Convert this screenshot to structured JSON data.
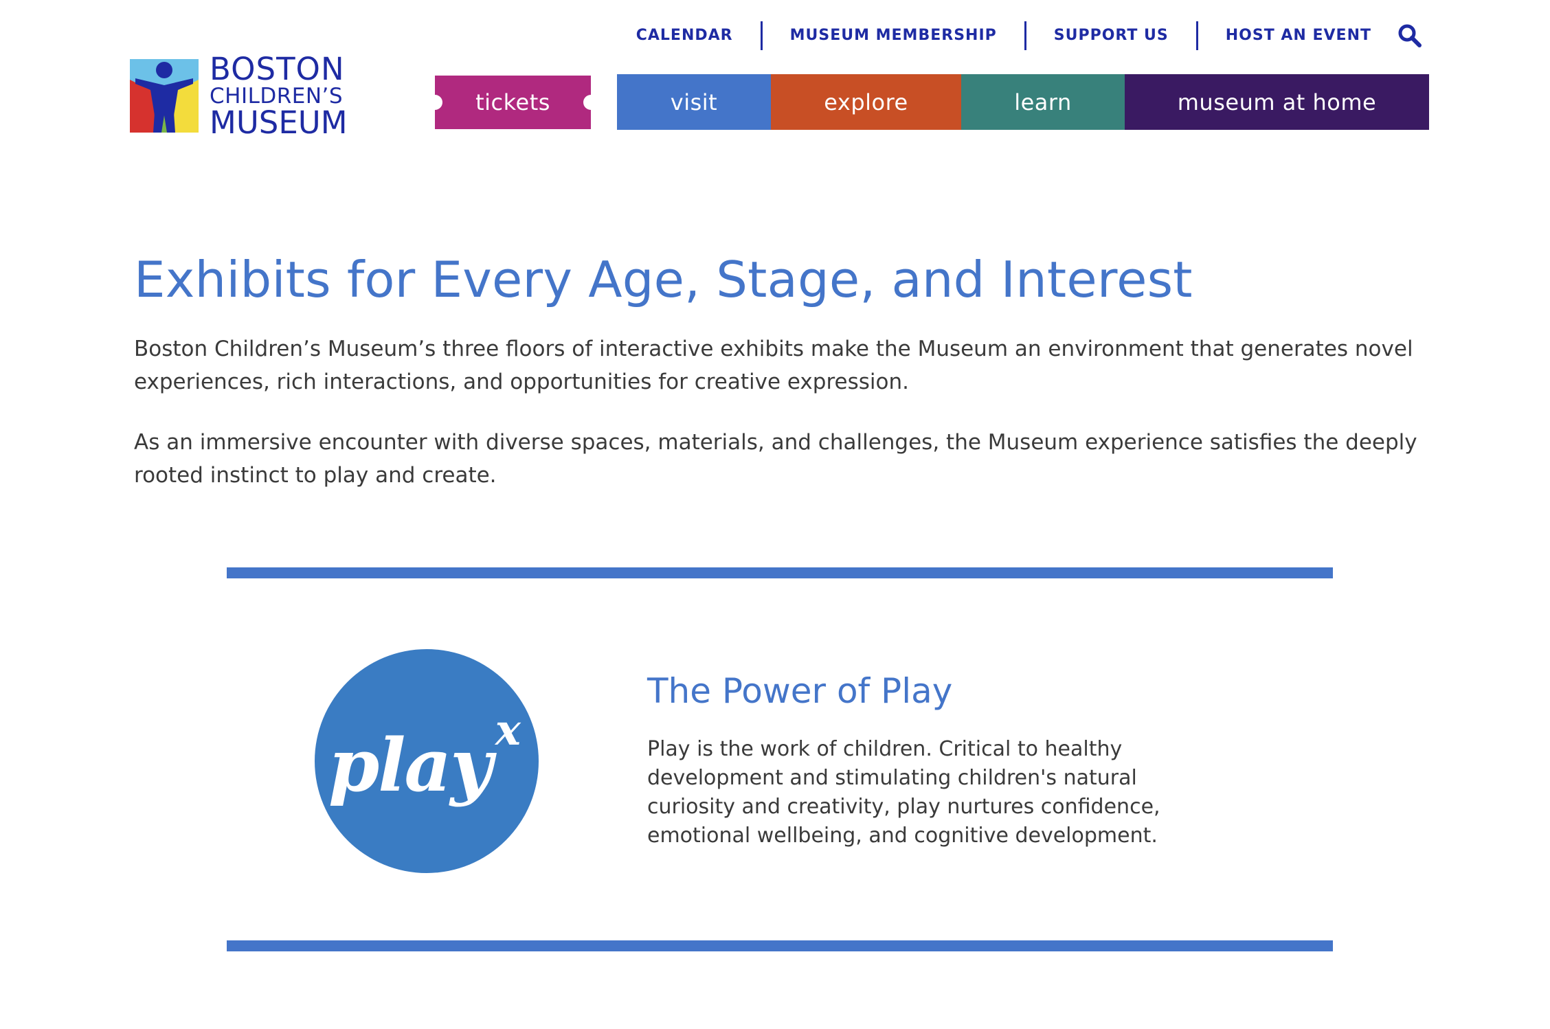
{
  "header": {
    "logo": {
      "line1": "BOSTON",
      "line2": "CHILDREN’S",
      "line3": "MUSEUM",
      "colors": {
        "sky": "#6cc1e8",
        "red": "#d6322e",
        "yellow": "#f3dc3c",
        "green": "#7ab648",
        "navy": "#1e2ba3"
      }
    },
    "utility_nav": [
      {
        "label": "CALENDAR"
      },
      {
        "label": "MUSEUM MEMBERSHIP"
      },
      {
        "label": "SUPPORT US"
      },
      {
        "label": "HOST AN EVENT"
      }
    ],
    "search_icon": "search-icon",
    "main_nav": {
      "tickets": "tickets",
      "visit": "visit",
      "explore": "explore",
      "learn": "learn",
      "museum_at_home": "museum at home"
    },
    "nav_colors": {
      "tickets": "#b0297f",
      "visit": "#4475c9",
      "explore": "#c84f25",
      "learn": "#38817b",
      "museum_at_home": "#3a1a62"
    }
  },
  "main": {
    "title": "Exhibits for Every Age, Stage, and Interest",
    "paragraphs": [
      "Boston Children’s Museum’s three floors of interactive exhibits make the Museum an environment that generates novel experiences, rich interactions, and opportunities for creative expression.",
      "As an immersive encounter with diverse spaces, materials, and challenges, the Museum experience satisfies the deeply rooted instinct to play and create."
    ],
    "feature": {
      "logo_word": "play",
      "logo_superscript": "x",
      "title": "The Power of Play",
      "body": "Play is the work of children. Critical to healthy development and stimulating children's natural curiosity and creativity, play nurtures confidence, emotional wellbeing, and cognitive development."
    },
    "accent_color": "#4475c9"
  }
}
